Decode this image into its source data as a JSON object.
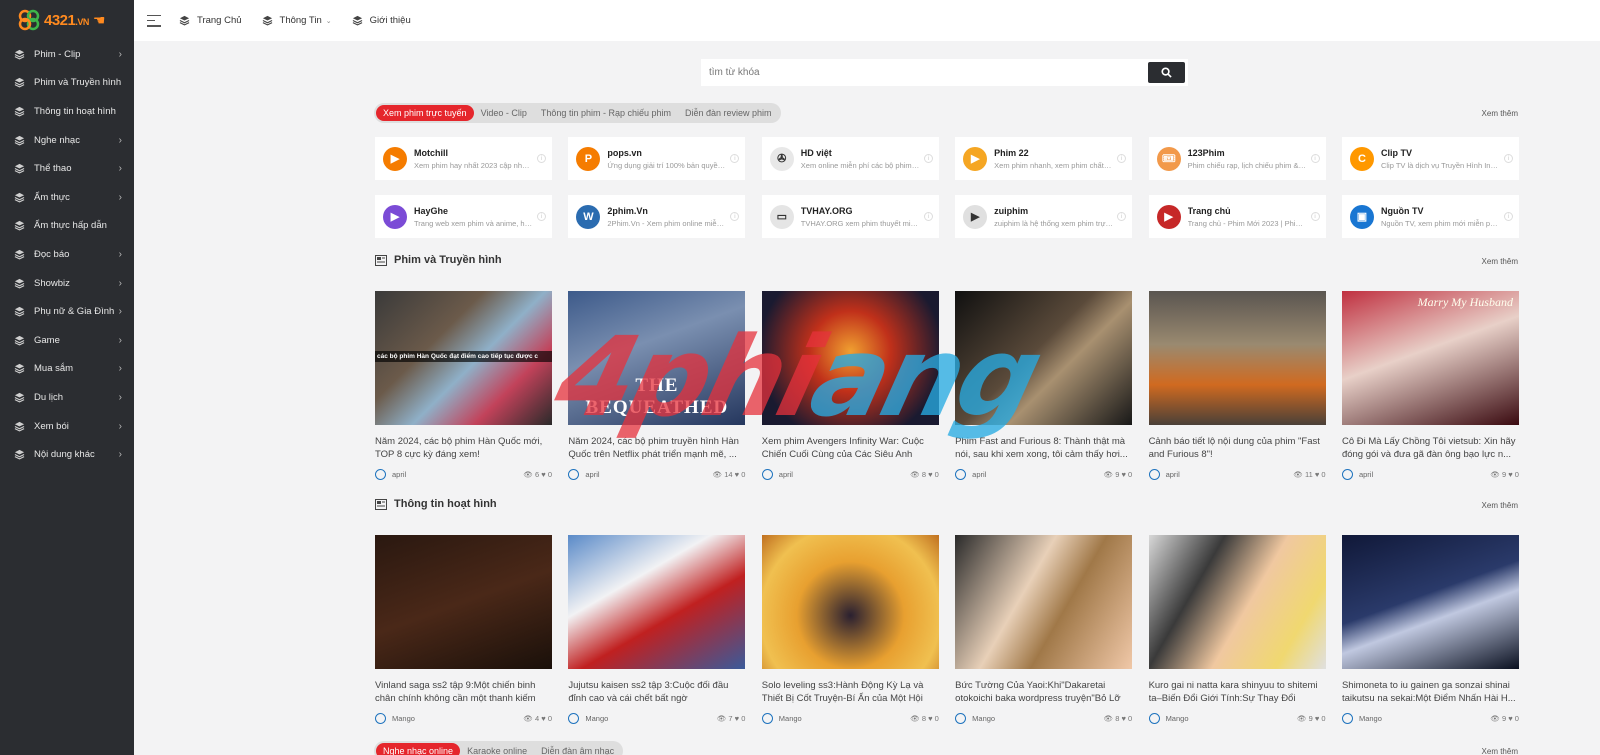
{
  "brand": {
    "logo_text": "4321",
    "logo_suffix": ".VN"
  },
  "sidebar": {
    "items": [
      {
        "label": "Phim - Clip",
        "has_children": true
      },
      {
        "label": "Phim và Truyền hình",
        "has_children": false
      },
      {
        "label": "Thông tin hoạt hình",
        "has_children": false
      },
      {
        "label": "Nghe nhạc",
        "has_children": true
      },
      {
        "label": "Thể thao",
        "has_children": true
      },
      {
        "label": "Ẩm thực",
        "has_children": true
      },
      {
        "label": "Ẩm thực hấp dẫn",
        "has_children": false
      },
      {
        "label": "Đọc báo",
        "has_children": true
      },
      {
        "label": "Showbiz",
        "has_children": true
      },
      {
        "label": "Phụ nữ & Gia Đình",
        "has_children": true
      },
      {
        "label": "Game",
        "has_children": true
      },
      {
        "label": "Mua sắm",
        "has_children": true
      },
      {
        "label": "Du lịch",
        "has_children": true
      },
      {
        "label": "Xem bói",
        "has_children": true
      },
      {
        "label": "Nội dung khác",
        "has_children": true
      }
    ]
  },
  "topbar": {
    "nav": [
      {
        "label": "Trang Chủ",
        "dropdown": false
      },
      {
        "label": "Thông Tin",
        "dropdown": true
      },
      {
        "label": "Giới thiệu",
        "dropdown": false
      }
    ]
  },
  "search": {
    "placeholder": "tìm từ khóa"
  },
  "see_more": "Xem thêm",
  "section_tabs": {
    "tabs": [
      "Xem phim trực tuyến",
      "Video - Clip",
      "Thông tin phim - Rạp chiếu phim",
      "Diễn đàn review phim"
    ],
    "active_index": 0
  },
  "links": [
    {
      "name": "Motchill",
      "desc": "Xem phim hay nhất 2023 cập nhật n...",
      "color": "#f57c00",
      "icon": "play-icon"
    },
    {
      "name": "pops.vn",
      "desc": "Ứng dụng giải trí 100% bản quyền v...",
      "color": "#f57c00",
      "icon": "p-letter-icon"
    },
    {
      "name": "HD việt",
      "desc": "Xem online miễn phí các bộ phim full...",
      "color": "#e8e8e8",
      "icon": "film-reel-icon"
    },
    {
      "name": "Phim 22",
      "desc": "Xem phim nhanh, xem phim chất lượ...",
      "color": "#f5a623",
      "icon": "play-circle-icon"
    },
    {
      "name": "123Phim",
      "desc": "Phim chiếu rạp, lịch chiếu phim &am...",
      "color": "#f2994a",
      "icon": "ticket-icon"
    },
    {
      "name": "Clip TV",
      "desc": "Clip TV là dịch vụ Truyền Hình Intern...",
      "color": "#ff9800",
      "icon": "c-letter-icon"
    },
    {
      "name": "HayGhe",
      "desc": "Trang web xem phim và anime, hoạt ...",
      "color": "#7b4bd6",
      "icon": "play-triangle-icon"
    },
    {
      "name": "2phim.Vn",
      "desc": "2Phim.Vn - Xem phim online miễn phí",
      "color": "#2b6cb0",
      "icon": "wordpress-icon"
    },
    {
      "name": "TVHAY.ORG",
      "desc": "TVHAY.ORG xem phim thuyết minh, l...",
      "color": "#e5e5e5",
      "icon": "tv-icon"
    },
    {
      "name": "zuiphim",
      "desc": "zuiphim là hệ thống xem phim trực t...",
      "color": "#e0e0e0",
      "icon": "play-circle-icon"
    },
    {
      "name": "Trang chủ",
      "desc": "Trang chủ - Phim Mới 2023 | Phim Ch...",
      "color": "#c62828",
      "icon": "play-circle-icon"
    },
    {
      "name": "Nguồn TV",
      "desc": "Nguồn TV, xem phim mới miễn phí n...",
      "color": "#1976d2",
      "icon": "tv-circle-icon"
    }
  ],
  "sections": [
    {
      "title": "Phim và Truyền hình",
      "posts": [
        {
          "title": "Năm 2024, các bộ phim Hàn Quốc mới, TOP 8 cực kỳ đáng xem!",
          "author": "april",
          "views": "6",
          "likes": "0",
          "thumb_text": "các bộ phim Hàn Quốc đạt điểm cao tiếp tục được c"
        },
        {
          "title": "Năm 2024, các bộ phim truyền hình Hàn Quốc trên Netflix phát triển mạnh mẽ, ...",
          "author": "april",
          "views": "14",
          "likes": "0",
          "thumb_text": "THE BEQUEATHED"
        },
        {
          "title": "Xem phim Avengers Infinity War: Cuộc Chiến Cuối Cùng của Các Siêu Anh Hùng...",
          "author": "april",
          "views": "8",
          "likes": "0",
          "thumb_text": ""
        },
        {
          "title": "Phim Fast and Furious 8: Thành thật mà nói, sau khi xem xong, tôi cảm thấy hơi...",
          "author": "april",
          "views": "9",
          "likes": "0",
          "thumb_text": ""
        },
        {
          "title": "Cảnh báo tiết lộ nội dung của phim \"Fast and Furious 8\"!",
          "author": "april",
          "views": "11",
          "likes": "0",
          "thumb_text": ""
        },
        {
          "title": "Cô Đi Mà Lấy Chồng Tôi vietsub: Xin hãy đóng gói và đưa gã đàn ông bạo lực n...",
          "author": "april",
          "views": "9",
          "likes": "0",
          "thumb_text": "Marry My Husband"
        }
      ]
    },
    {
      "title": "Thông tin hoạt hình",
      "posts": [
        {
          "title": "Vinland saga ss2 tập 9:Một chiến binh chân chính không cần một thanh kiếm",
          "author": "Mango",
          "views": "4",
          "likes": "0",
          "thumb_text": ""
        },
        {
          "title": "Jujutsu kaisen ss2 tập 3:Cuộc đối đầu đỉnh cao và cái chết bất ngờ",
          "author": "Mango",
          "views": "7",
          "likes": "0",
          "thumb_text": ""
        },
        {
          "title": "Solo leveling ss3:Hành Động Kỳ Lạ và Thiết Bị Cốt Truyện-Bí Ẩn của Một Hội tro...",
          "author": "Mango",
          "views": "8",
          "likes": "0",
          "thumb_text": ""
        },
        {
          "title": "Bức Tường Của Yaoi:Khi\"Dakaretai otokoichi baka wordpress truyện\"Bỏ Lỡ Cơ ...",
          "author": "Mango",
          "views": "8",
          "likes": "0",
          "thumb_text": ""
        },
        {
          "title": "Kuro gai ni natta kara shinyuu to shitemi ta–Biến Đổi Giới Tính:Sự Thay Đổi Khôn...",
          "author": "Mango",
          "views": "9",
          "likes": "0",
          "thumb_text": ""
        },
        {
          "title": "Shimoneta to iu gainen ga sonzai shinai taikutsu na sekai:Một Điểm Nhấn Hài H...",
          "author": "Mango",
          "views": "9",
          "likes": "0",
          "thumb_text": ""
        }
      ]
    }
  ],
  "bottom_tabs": {
    "tabs": [
      "Nghe nhạc online",
      "Karaoke online",
      "Diễn đàn âm nhạc"
    ],
    "active_index": 0
  },
  "watermark": {
    "part_a": "4phi",
    "part_b": "ang"
  },
  "colors": {
    "accent": "#e5262c",
    "sidebar_bg": "#2b2d31",
    "logo_orange": "#ff8a1f"
  }
}
